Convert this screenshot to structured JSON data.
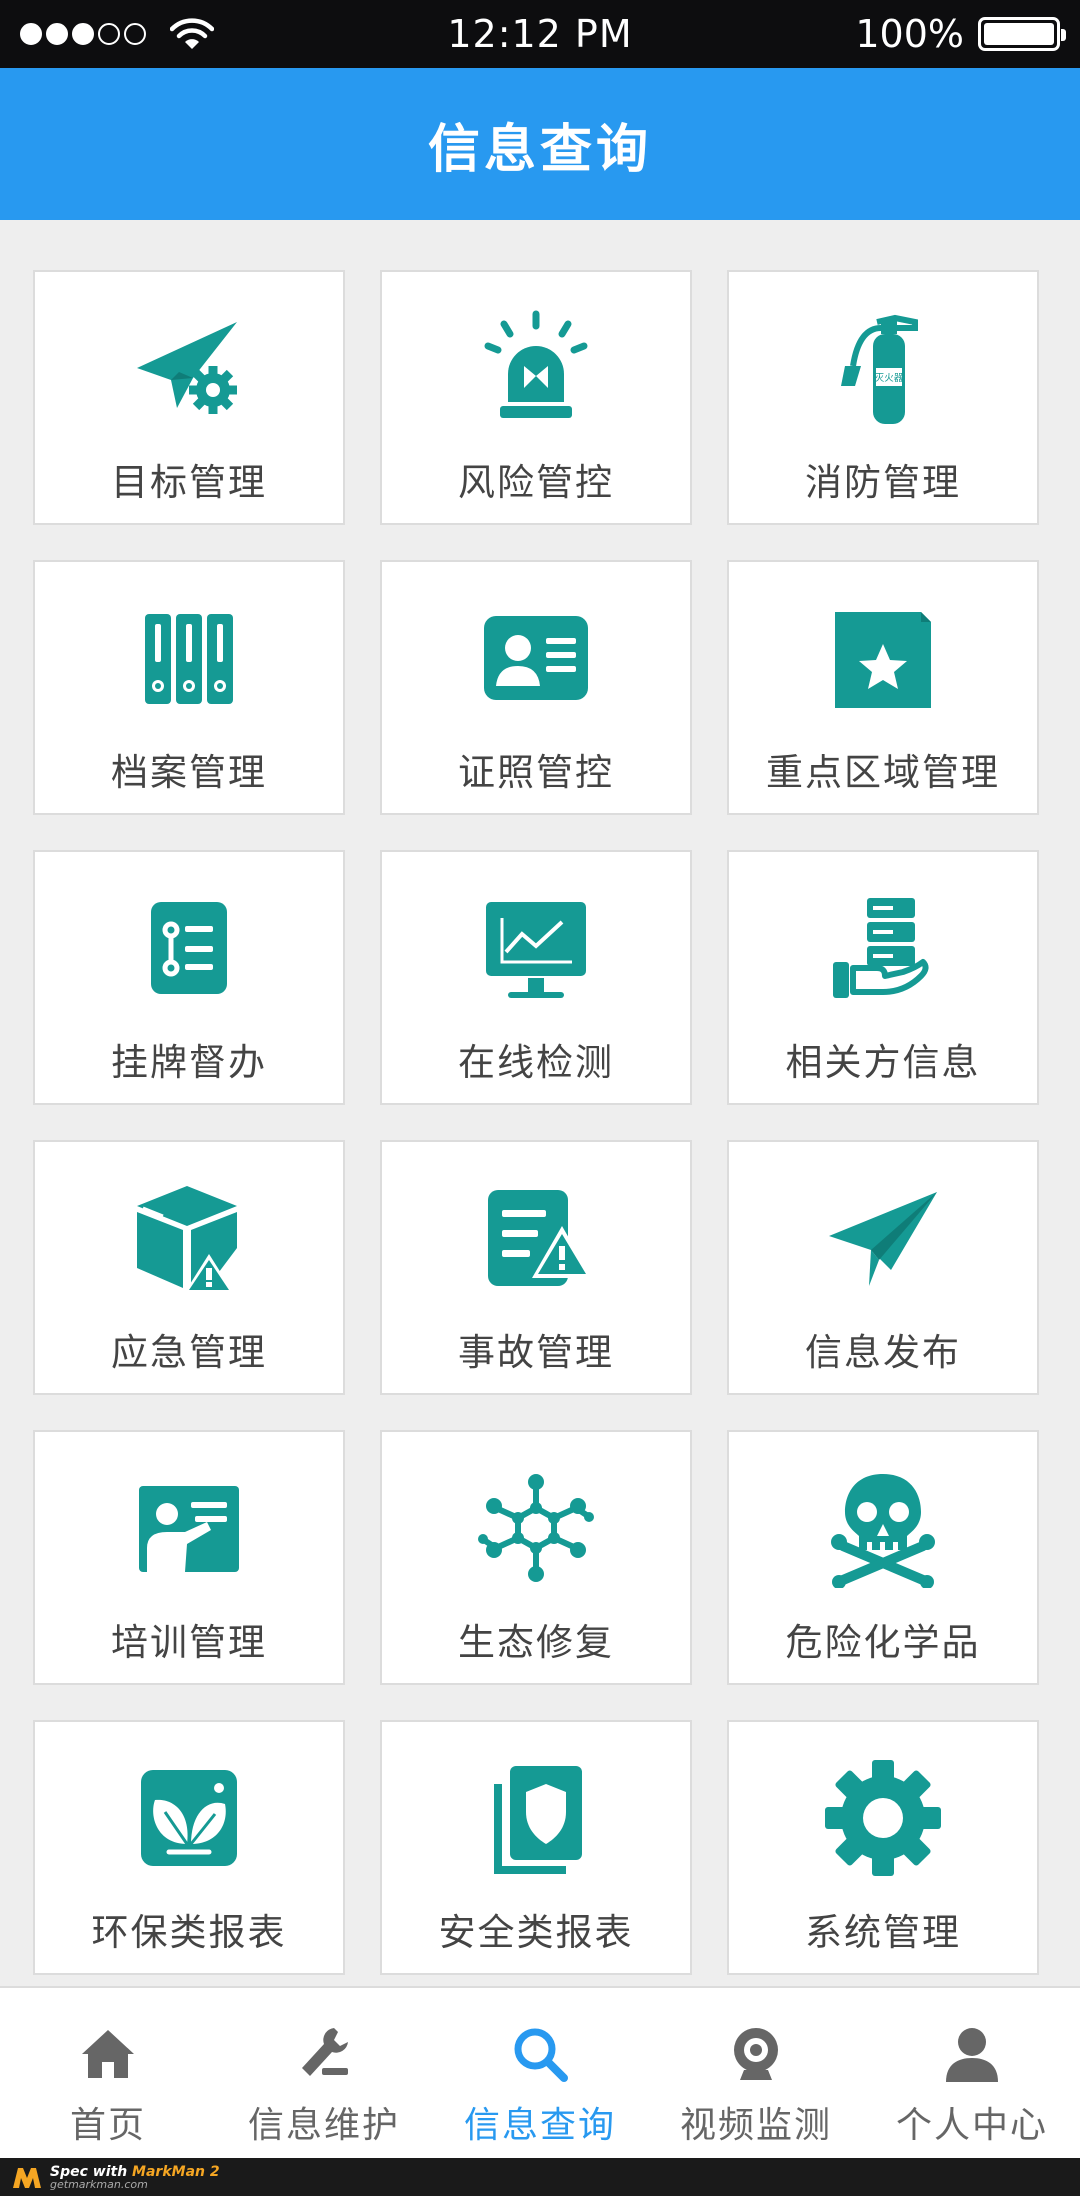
{
  "status_bar": {
    "time": "12:12 PM",
    "battery": "100%"
  },
  "header": {
    "title": "信息查询",
    "color": "#2899f0"
  },
  "colors": {
    "icon": "#159a94",
    "page_bg": "#eeeeee",
    "tile_border": "#dcdcdc",
    "tile_bg": "#ffffff",
    "active": "#2899f0"
  },
  "tiles": [
    {
      "label": "目标管理",
      "icon": "target-icon"
    },
    {
      "label": "风险管控",
      "icon": "alarm-light-icon"
    },
    {
      "label": "消防管理",
      "icon": "fire-extinguisher-icon",
      "icon_text": "灭火器"
    },
    {
      "label": "档案管理",
      "icon": "binders-icon"
    },
    {
      "label": "证照管控",
      "icon": "id-card-icon"
    },
    {
      "label": "重点区域管理",
      "icon": "star-folder-icon"
    },
    {
      "label": "挂牌督办",
      "icon": "checklist-icon"
    },
    {
      "label": "在线检测",
      "icon": "monitor-chart-icon"
    },
    {
      "label": "相关方信息",
      "icon": "server-hand-icon"
    },
    {
      "label": "应急管理",
      "icon": "box-warning-icon"
    },
    {
      "label": "事故管理",
      "icon": "document-warning-icon"
    },
    {
      "label": "信息发布",
      "icon": "paper-plane-icon"
    },
    {
      "label": "培训管理",
      "icon": "teacher-board-icon"
    },
    {
      "label": "生态修复",
      "icon": "molecule-icon"
    },
    {
      "label": "危险化学品",
      "icon": "skull-crossbones-icon"
    },
    {
      "label": "环保类报表",
      "icon": "leaf-card-icon"
    },
    {
      "label": "安全类报表",
      "icon": "shield-document-icon"
    },
    {
      "label": "系统管理",
      "icon": "gear-icon"
    }
  ],
  "nav": [
    {
      "label": "首页",
      "icon": "home-icon",
      "active": false
    },
    {
      "label": "信息维护",
      "icon": "tools-icon",
      "active": false
    },
    {
      "label": "信息查询",
      "icon": "search-icon",
      "active": true
    },
    {
      "label": "视频监测",
      "icon": "webcam-icon",
      "active": false
    },
    {
      "label": "个人中心",
      "icon": "person-icon",
      "active": false
    }
  ],
  "watermark": {
    "prefix": "Spec with ",
    "brand": "MarkMan 2",
    "url": "getmarkman.com"
  }
}
